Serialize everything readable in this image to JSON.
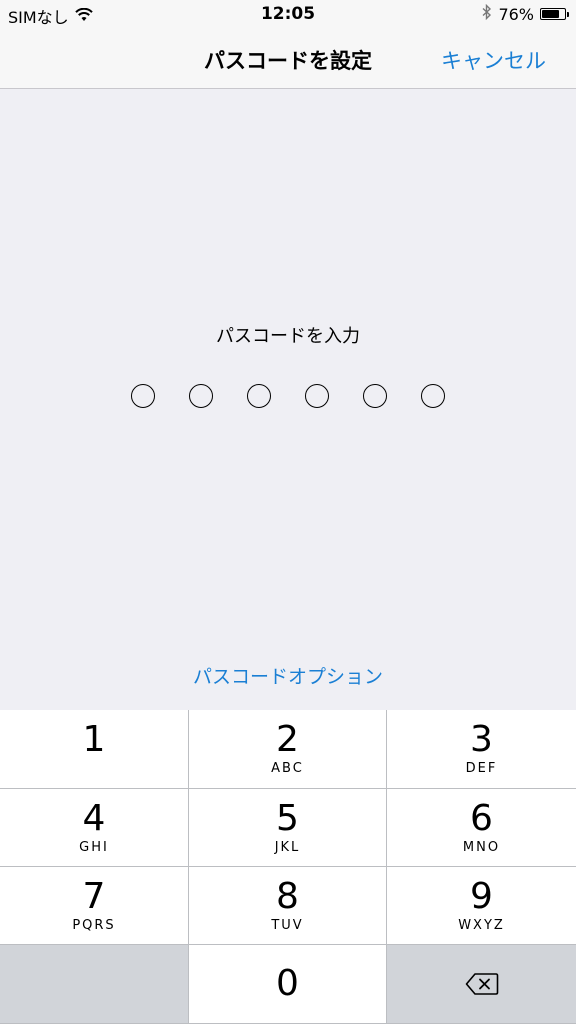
{
  "status_bar": {
    "carrier": "SIMなし",
    "time": "12:05",
    "battery_percent": "76%",
    "battery_level": 0.76,
    "icons": [
      "wifi-icon",
      "bluetooth-icon",
      "battery-icon"
    ]
  },
  "nav": {
    "title": "パスコードを設定",
    "cancel_label": "キャンセル"
  },
  "passcode": {
    "prompt": "パスコードを入力",
    "digit_count": 6,
    "entered": 0
  },
  "options_link": "パスコードオプション",
  "keypad": {
    "keys": [
      {
        "digit": "1",
        "letters": ""
      },
      {
        "digit": "2",
        "letters": "ABC"
      },
      {
        "digit": "3",
        "letters": "DEF"
      },
      {
        "digit": "4",
        "letters": "GHI"
      },
      {
        "digit": "5",
        "letters": "JKL"
      },
      {
        "digit": "6",
        "letters": "MNO"
      },
      {
        "digit": "7",
        "letters": "PQRS"
      },
      {
        "digit": "8",
        "letters": "TUV"
      },
      {
        "digit": "9",
        "letters": "WXYZ"
      },
      {
        "digit": "0",
        "letters": ""
      }
    ],
    "delete_icon": "delete-backspace-icon"
  },
  "colors": {
    "accent": "#1a7fd4",
    "background": "#efeff4",
    "key_dark": "#d1d4d9"
  }
}
